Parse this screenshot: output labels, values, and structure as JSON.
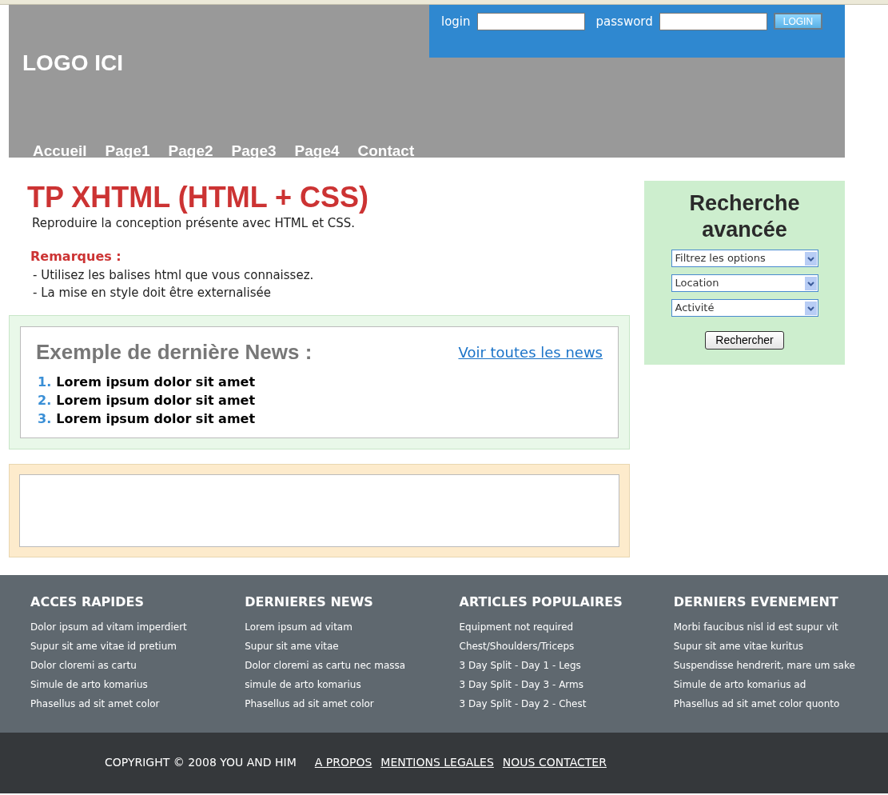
{
  "header": {
    "logo": "LOGO ICI",
    "login": {
      "login_label": "login",
      "password_label": "password",
      "button": "LOGIN"
    },
    "nav": [
      "Accueil",
      "Page1",
      "Page2",
      "Page3",
      "Page4",
      "Contact"
    ]
  },
  "intro": {
    "title": "TP XHTML (HTML + CSS)",
    "text": "Reproduire la conception présente avec HTML et CSS.",
    "remarks_title": "Remarques :",
    "remarks": [
      "- Utilisez les balises html que vous connaissez.",
      "- La mise en style doit être externalisée"
    ]
  },
  "news": {
    "title": "Exemple de dernière News :",
    "link": "Voir toutes les news",
    "items": [
      {
        "number": "1.",
        "text": "Lorem ipsum dolor sit amet"
      },
      {
        "number": "2.",
        "text": "Lorem ipsum dolor sit amet"
      },
      {
        "number": "3.",
        "text": "Lorem ipsum dolor sit amet"
      }
    ]
  },
  "search": {
    "title": "Recherche avancée",
    "selects": [
      "Filtrez les options",
      "Location",
      "Activité"
    ],
    "button": "Rechercher"
  },
  "footer": {
    "columns": [
      {
        "title": "ACCES RAPIDES",
        "links": [
          "Dolor ipsum ad vitam imperdiert",
          "Supur sit ame vitae id pretium",
          "Dolor cloremi as cartu",
          "Simule de arto komarius",
          "Phasellus ad sit amet color"
        ]
      },
      {
        "title": "DERNIERES NEWS",
        "links": [
          "Lorem ipsum ad vitam",
          "Supur sit ame vitae",
          "Dolor cloremi as cartu nec massa",
          "simule de arto komarius",
          "Phasellus ad sit amet color"
        ]
      },
      {
        "title": "ARTICLES POPULAIRES",
        "links": [
          "Equipment not required",
          "Chest/Shoulders/Triceps",
          "3 Day Split - Day 1 - Legs",
          "3 Day Split - Day 3 - Arms",
          "3 Day Split - Day 2 - Chest"
        ]
      },
      {
        "title": "DERNIERS EVENEMENT",
        "links": [
          "Morbi faucibus nisl id est supur vit",
          "Supur sit ame vitae kuritus",
          "Suspendisse hendrerit, mare um sake",
          "Simule de arto komarius ad",
          "Phasellus ad sit amet color quonto"
        ]
      }
    ],
    "copyright": "COPYRIGHT © 2008 YOU AND HIM",
    "links": [
      "A PROPOS",
      "MENTIONS LEGALES",
      "NOUS CONTACTER"
    ]
  }
}
